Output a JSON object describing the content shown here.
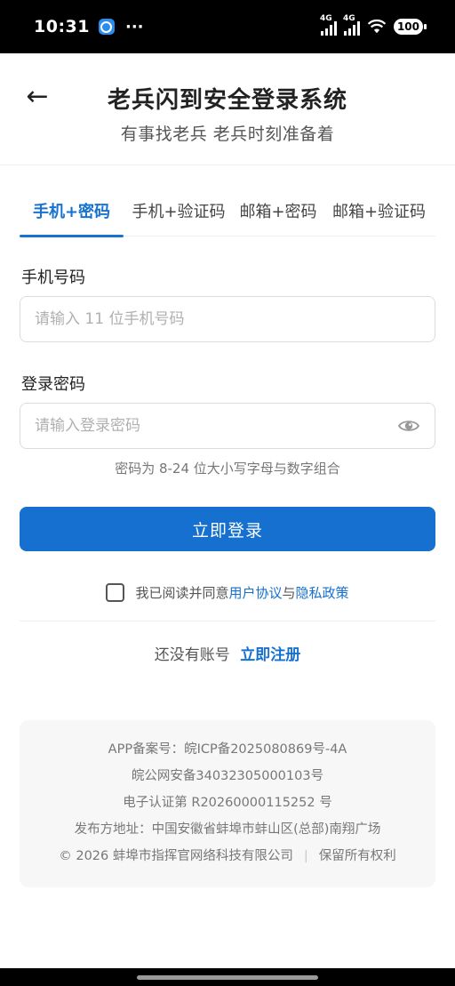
{
  "status_bar": {
    "time": "10:31",
    "more": "···",
    "signal1_label": "4G",
    "signal2_label": "4G",
    "battery": "100"
  },
  "header": {
    "back_icon": "←",
    "title": "老兵闪到安全登录系统",
    "subtitle": "有事找老兵 老兵时刻准备着"
  },
  "tabs": [
    {
      "label": "手机+密码",
      "active": true
    },
    {
      "label": "手机+验证码",
      "active": false
    },
    {
      "label": "邮箱+密码",
      "active": false
    },
    {
      "label": "邮箱+验证码",
      "active": false
    }
  ],
  "form": {
    "phone_label": "手机号码",
    "phone_placeholder": "请输入 11 位手机号码",
    "phone_value": "",
    "password_label": "登录密码",
    "password_placeholder": "请输入登录密码",
    "password_value": "",
    "password_hint": "密码为 8-24 位大小写字母与数字组合",
    "login_button": "立即登录"
  },
  "agreement": {
    "prefix": "我已阅读并同意",
    "user_agreement": "用户协议",
    "conjunction": "与",
    "privacy_policy": "隐私政策",
    "checked": false
  },
  "register": {
    "prompt": "还没有账号",
    "link": "立即注册"
  },
  "footer": {
    "app_record": "APP备案号：皖ICP备2025080869号-4A",
    "police_record": "皖公网安备34032305000103号",
    "cert": "电子认证第 R20260000115252 号",
    "address": "发布方地址：中国安徽省蚌埠市蚌山区(总部)南翔广场",
    "copyright": "© 2026 蚌埠市指挥官网络科技有限公司",
    "separator": "|",
    "rights": "保留所有权利"
  },
  "colors": {
    "accent": "#1670cf",
    "text": "#222222",
    "muted": "#777777"
  }
}
